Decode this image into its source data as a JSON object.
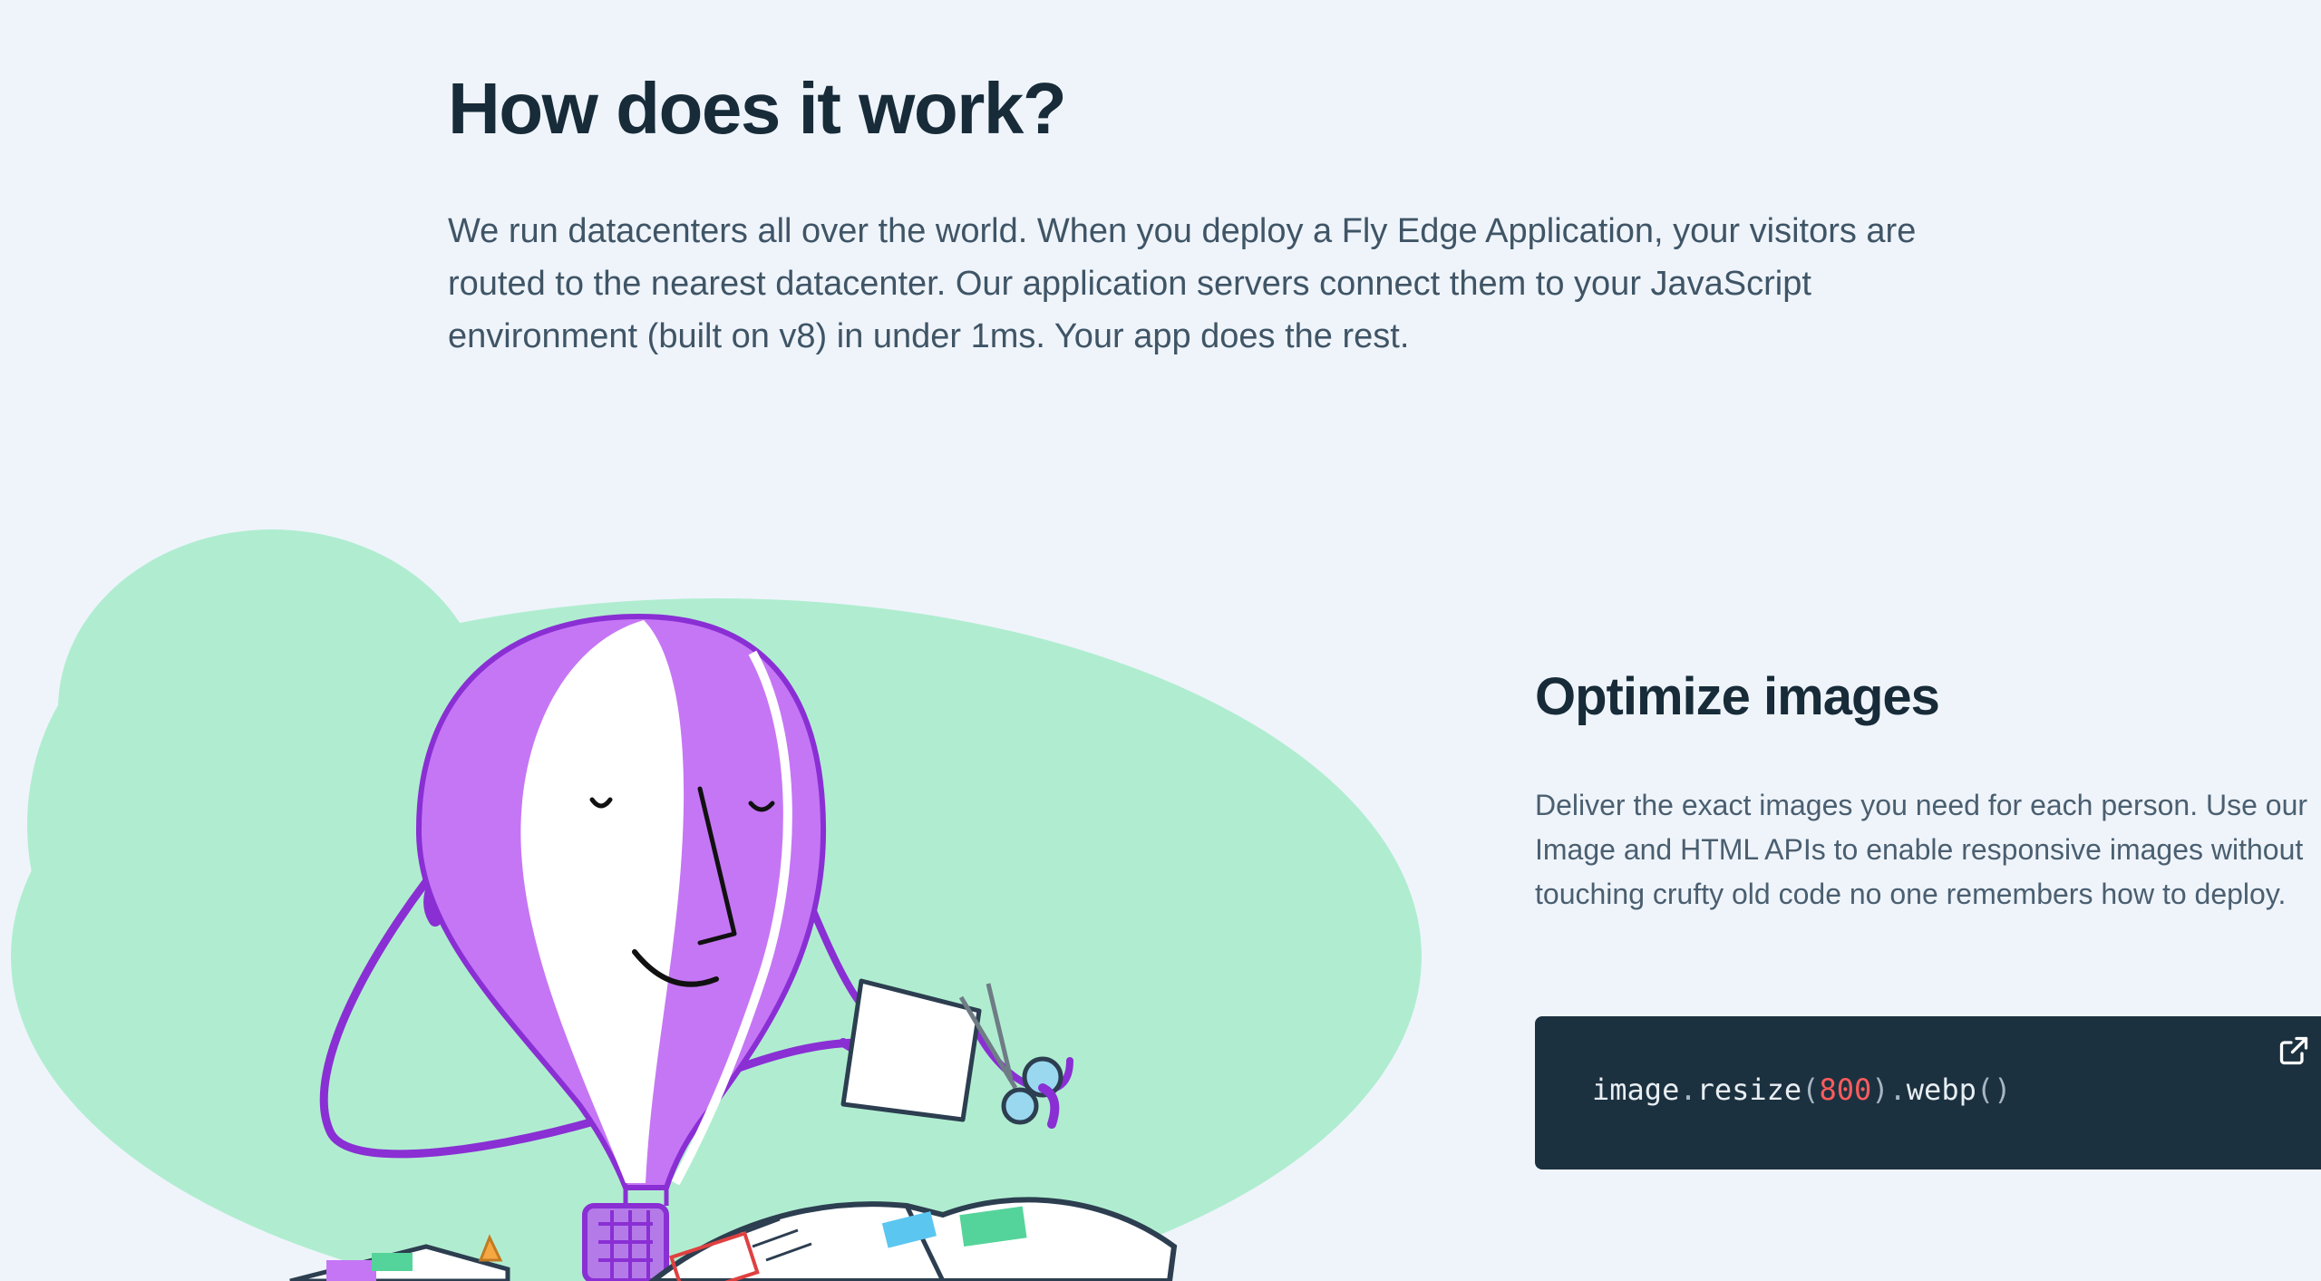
{
  "section": {
    "title": "How does it work?",
    "intro": "We run datacenters all over the world. When you deploy a Fly Edge Application, your visitors are routed to the nearest datacenter. Our application servers connect them to your JavaScript environment (built on v8) in under 1ms. Your app does the rest."
  },
  "feature": {
    "title": "Optimize images",
    "description": "Deliver the exact images you need for each person. Use our Image and HTML APIs to enable responsive images without touching crufty old code no one remembers how to deploy.",
    "code": {
      "object": "image",
      "dot1": ".",
      "method1": "resize",
      "open1": "(",
      "arg": "800",
      "close1": ")",
      "dot2": ".",
      "method2": "webp",
      "parens2": "()"
    },
    "open_icon": "external-link-icon"
  },
  "colors": {
    "background": "#eff4fb",
    "blob": "#b0edd0",
    "balloon_purple": "#c576f5",
    "balloon_outline": "#8a2fd4",
    "code_bg": "#1c3140",
    "number": "#ff5c5c"
  }
}
